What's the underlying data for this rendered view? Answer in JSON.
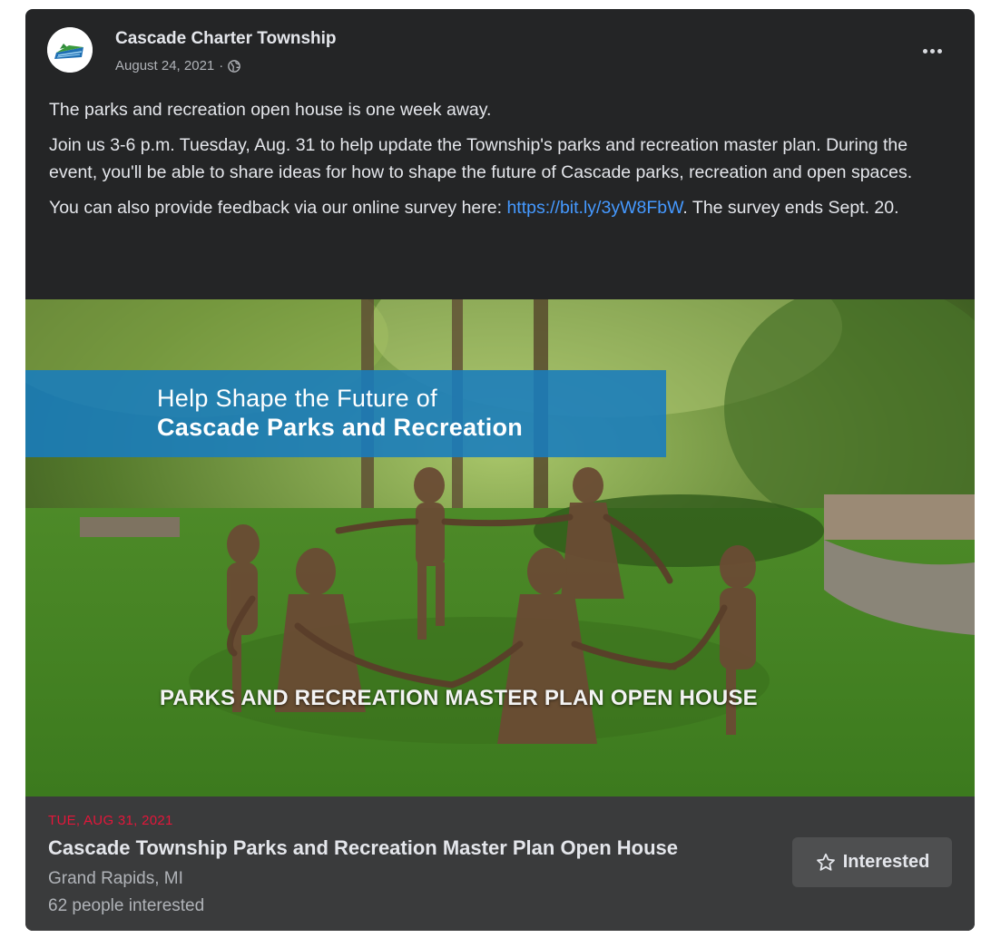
{
  "post": {
    "page_name": "Cascade Charter Township",
    "date": "August 24, 2021",
    "separator": "·",
    "audience_icon": "globe-icon",
    "more_icon": "more-options-icon",
    "avatar_logo": "cascade-township-logo",
    "text": {
      "p1": "The parks and recreation open house is one week away.",
      "p2": "Join us 3-6 p.m. Tuesday, Aug. 31 to help update the Township's parks and recreation master plan. During the event, you'll be able to share ideas for how to shape the future of Cascade parks, recreation and open spaces.",
      "p3_before": "You can also provide feedback via our online survey here: ",
      "p3_link": "https://bit.ly/3yW8FbW",
      "p3_after": ". The survey ends Sept. 20."
    }
  },
  "image": {
    "banner_line1": "Help Shape the Future of",
    "banner_line2": "Cascade Parks and Recreation",
    "caption": "PARKS AND RECREATION MASTER PLAN OPEN HOUSE"
  },
  "event": {
    "date": "TUE, AUG 31, 2021",
    "title": "Cascade Township Parks and Recreation Master Plan Open House",
    "location": "Grand Rapids, MI",
    "interested_count": "62 people interested",
    "interested_button": "Interested",
    "interested_icon": "star-icon"
  },
  "colors": {
    "card_bg": "#242526",
    "event_bg": "#3a3b3c",
    "link": "#4599ff",
    "event_date": "#e4163a",
    "banner": "#187cbe"
  }
}
